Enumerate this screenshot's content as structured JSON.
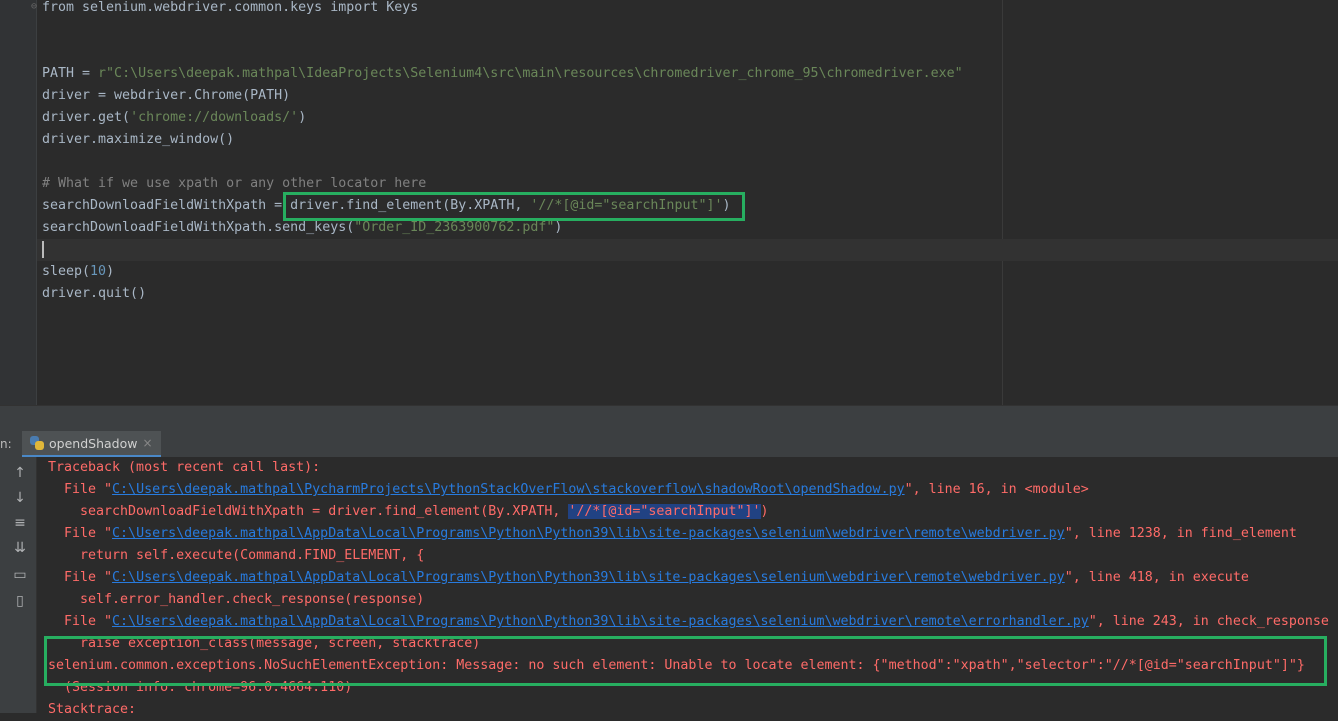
{
  "editor": {
    "lines": {
      "l1": "from selenium.webdriver.common.keys import Keys",
      "path_pre": "PATH = ",
      "path_str": "r\"C:\\Users\\deepak.mathpal\\IdeaProjects\\Selenium4\\src\\main\\resources\\chromedriver_chrome_95\\chromedriver.exe\"",
      "driver_init": "driver = webdriver.Chrome(PATH)",
      "get_pre": "driver.get(",
      "get_str": "'chrome://downloads/'",
      "get_post": ")",
      "maximize": "driver.maximize_window()",
      "comment": "# What if we use xpath or any other locator here",
      "find_pre": "searchDownloadFieldWithXpath = ",
      "find_call": "driver.find_element(By.XPATH, ",
      "find_str": "'//*[@id=\"searchInput\"]'",
      "find_post": ")",
      "send_pre": "searchDownloadFieldWithXpath.send_keys(",
      "send_str": "\"Order_ID_2363900762.pdf\"",
      "send_post": ")",
      "sleep_pre": "sleep(",
      "sleep_num": "10",
      "sleep_post": ")",
      "quit": "driver.quit()"
    }
  },
  "run_panel": {
    "label": "n:",
    "tab_label": "opendShadow",
    "close_glyph": "×"
  },
  "toolbar_icons": [
    "arrow-up-icon",
    "arrow-down-icon",
    "soft-wrap-icon",
    "scroll-to-end-icon",
    "print-icon",
    "trash-icon"
  ],
  "console": {
    "traceback": "Traceback (most recent call last):",
    "f1_pre": "  File \"",
    "f1_link": "C:\\Users\\deepak.mathpal\\PycharmProjects\\PythonStackOverFlow\\stackoverflow\\shadowRoot\\opendShadow.py",
    "f1_post": "\", line 16, in <module>",
    "c1_pre": "    searchDownloadFieldWithXpath = driver.find_element(By.XPATH, ",
    "c1_hl": "'//*[@id=\"searchInput\"]'",
    "c1_post": ")",
    "f2_pre": "  File \"",
    "f2_link": "C:\\Users\\deepak.mathpal\\AppData\\Local\\Programs\\Python\\Python39\\lib\\site-packages\\selenium\\webdriver\\remote\\webdriver.py",
    "f2_post": "\", line 1238, in find_element",
    "c2": "    return self.execute(Command.FIND_ELEMENT, {",
    "f3_pre": "  File \"",
    "f3_link": "C:\\Users\\deepak.mathpal\\AppData\\Local\\Programs\\Python\\Python39\\lib\\site-packages\\selenium\\webdriver\\remote\\webdriver.py",
    "f3_post": "\", line 418, in execute",
    "c3": "    self.error_handler.check_response(response)",
    "f4_pre": "  File \"",
    "f4_link": "C:\\Users\\deepak.mathpal\\AppData\\Local\\Programs\\Python\\Python39\\lib\\site-packages\\selenium\\webdriver\\remote\\errorhandler.py",
    "f4_post": "\", line 243, in check_response",
    "c4": "    raise exception_class(message, screen, stacktrace)",
    "exception": "selenium.common.exceptions.NoSuchElementException: Message: no such element: Unable to locate element: {\"method\":\"xpath\",\"selector\":\"//*[@id=\"searchInput\"]\"}",
    "session": "  (Session info: chrome=96.0.4664.110)",
    "stacktrace": "Stacktrace:"
  },
  "colors": {
    "highlight_box": "#27ae60",
    "error_text": "#ff6b68",
    "link": "#287bde",
    "string": "#6a8759"
  }
}
